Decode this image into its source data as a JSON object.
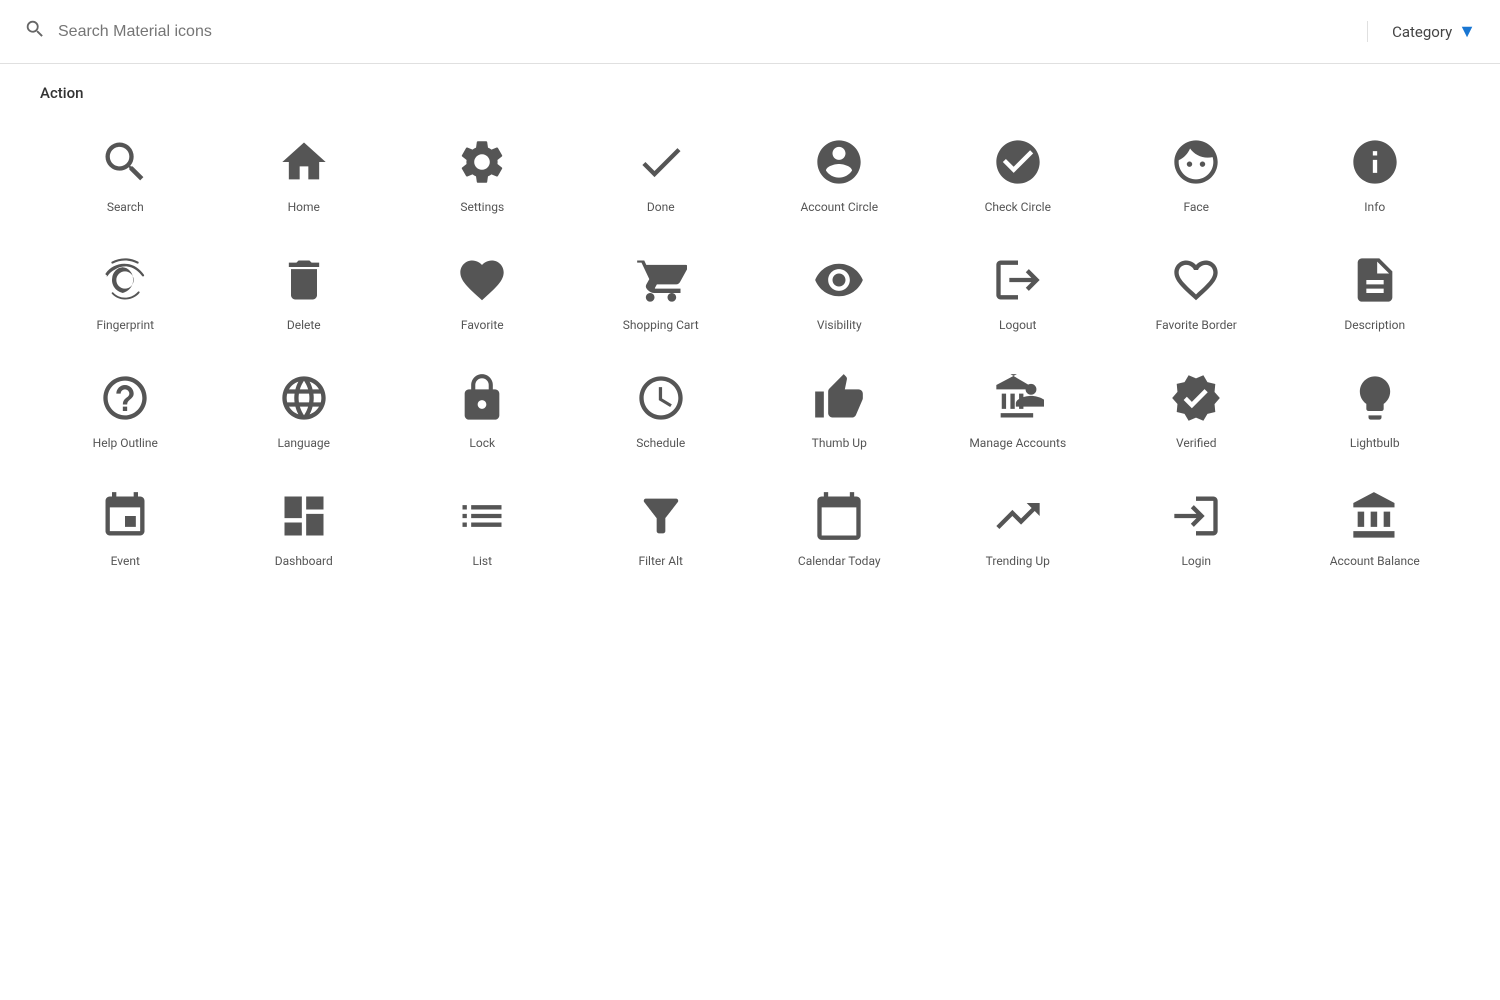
{
  "header": {
    "search_placeholder": "Search Material icons",
    "category_label": "Category"
  },
  "category_section": {
    "title": "Action",
    "icons": [
      {
        "id": "search",
        "label": "Search"
      },
      {
        "id": "home",
        "label": "Home"
      },
      {
        "id": "settings",
        "label": "Settings"
      },
      {
        "id": "done",
        "label": "Done"
      },
      {
        "id": "account_circle",
        "label": "Account Circle"
      },
      {
        "id": "check_circle",
        "label": "Check Circle"
      },
      {
        "id": "face",
        "label": "Face"
      },
      {
        "id": "info",
        "label": "Info"
      },
      {
        "id": "fingerprint",
        "label": "Fingerprint"
      },
      {
        "id": "delete",
        "label": "Delete"
      },
      {
        "id": "favorite",
        "label": "Favorite"
      },
      {
        "id": "shopping_cart",
        "label": "Shopping Cart"
      },
      {
        "id": "visibility",
        "label": "Visibility"
      },
      {
        "id": "logout",
        "label": "Logout"
      },
      {
        "id": "favorite_border",
        "label": "Favorite Border"
      },
      {
        "id": "description",
        "label": "Description"
      },
      {
        "id": "help_outline",
        "label": "Help Outline"
      },
      {
        "id": "language",
        "label": "Language"
      },
      {
        "id": "lock",
        "label": "Lock"
      },
      {
        "id": "schedule",
        "label": "Schedule"
      },
      {
        "id": "thumb_up",
        "label": "Thumb Up"
      },
      {
        "id": "manage_accounts",
        "label": "Manage Accounts"
      },
      {
        "id": "verified",
        "label": "Verified"
      },
      {
        "id": "lightbulb",
        "label": "Lightbulb"
      },
      {
        "id": "event",
        "label": "Event"
      },
      {
        "id": "dashboard",
        "label": "Dashboard"
      },
      {
        "id": "list",
        "label": "List"
      },
      {
        "id": "filter_alt",
        "label": "Filter Alt"
      },
      {
        "id": "calendar_today",
        "label": "Calendar Today"
      },
      {
        "id": "trending_up",
        "label": "Trending Up"
      },
      {
        "id": "login",
        "label": "Login"
      },
      {
        "id": "account_balance",
        "label": "Account Balance"
      }
    ]
  }
}
